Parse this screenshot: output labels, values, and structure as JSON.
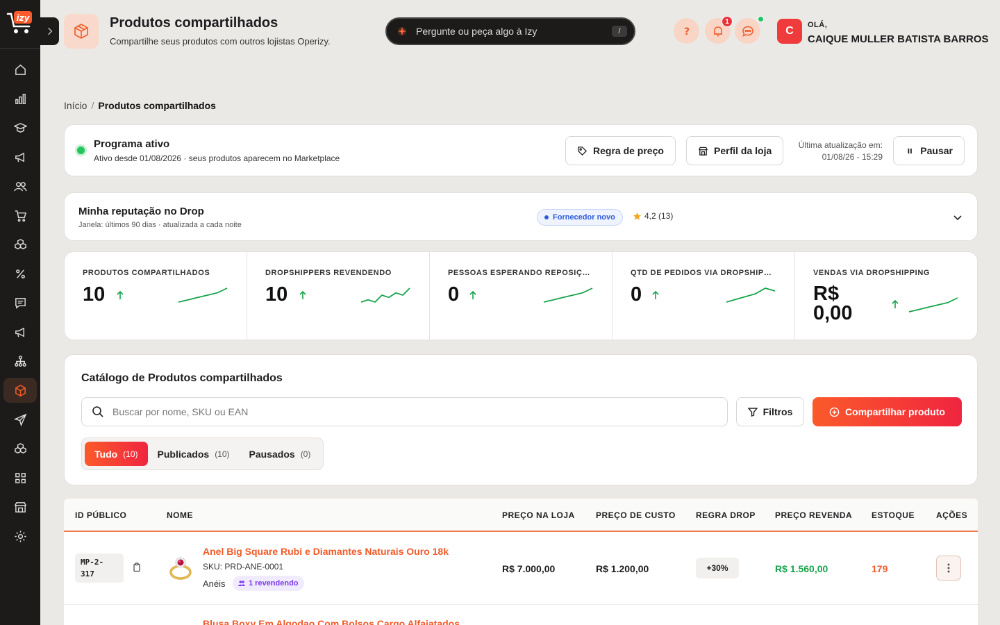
{
  "header": {
    "title": "Produtos compartilhados",
    "subtitle": "Compartilhe seus produtos com outros lojistas Operizy.",
    "ask_placeholder": "Pergunte ou peça algo à Izy",
    "ask_shortcut": "/",
    "notif_count": "1",
    "greeting": "OLÁ,",
    "user_name": "CAIQUE MULLER BATISTA BARROS",
    "avatar_initial": "C"
  },
  "breadcrumb": {
    "home": "Início",
    "sep": "/",
    "current": "Produtos compartilhados"
  },
  "program": {
    "title": "Programa ativo",
    "subtitle": "Ativo desde 01/08/2026 · seus produtos aparecem no Marketplace",
    "price_rule_btn": "Regra de preço",
    "store_profile_btn": "Perfil da loja",
    "updated_label": "Última atualização em:",
    "updated_value": "01/08/26 - 15:29",
    "pause_btn": "Pausar"
  },
  "reputation": {
    "title": "Minha reputação no Drop",
    "subtitle": "Janela: últimos 90 dias · atualizada a cada noite",
    "badge": "Fornecedor novo",
    "rating": "4,2 (13)"
  },
  "metrics": [
    {
      "label": "PRODUTOS COMPARTILHADOS",
      "value": "10",
      "trend": [
        3,
        4,
        5,
        6,
        7,
        9
      ]
    },
    {
      "label": "DROPSHIPPERS REVENDENDO",
      "value": "10",
      "trend": [
        3,
        4,
        3,
        6,
        5,
        7,
        6,
        9
      ]
    },
    {
      "label": "PESSOAS ESPERANDO REPOSIÇÃO",
      "value": "0",
      "trend": [
        3,
        4,
        5,
        6,
        7,
        9
      ]
    },
    {
      "label": "QTD DE PEDIDOS VIA DROPSHIPPI...",
      "value": "0",
      "trend": [
        3,
        4,
        5,
        6,
        8,
        7
      ]
    },
    {
      "label": "VENDAS VIA DROPSHIPPING",
      "value": "R$ 0,00",
      "value_line1": "R$",
      "value_line2": "0,00",
      "trend": [
        3,
        4,
        5,
        6,
        7,
        9
      ]
    }
  ],
  "catalog": {
    "title": "Catálogo de Produtos compartilhados",
    "search_placeholder": "Buscar por nome, SKU ou EAN",
    "filters_btn": "Filtros",
    "share_btn": "Compartilhar produto",
    "tabs": [
      {
        "label": "Tudo",
        "count": "(10)"
      },
      {
        "label": "Publicados",
        "count": "(10)"
      },
      {
        "label": "Pausados",
        "count": "(0)"
      }
    ]
  },
  "table": {
    "columns": [
      "ID PÚBLICO",
      "NOME",
      "PREÇO NA LOJA",
      "PREÇO DE CUSTO",
      "REGRA DROP",
      "PREÇO REVENDA",
      "ESTOQUE",
      "AÇÕES"
    ],
    "rows": [
      {
        "id_line1": "MP-2-",
        "id_line2": "317",
        "name": "Anel Big Square Rubi e Diamantes Naturais Ouro 18k",
        "sku": "SKU: PRD-ANE-0001",
        "category": "Anéis",
        "resellers": "1 revendendo",
        "store_price": "R$ 7.000,00",
        "cost_price": "R$ 1.200,00",
        "drop_rule": "+30%",
        "resale_price": "R$ 1.560,00",
        "stock": "179"
      },
      {
        "name": "Blusa Boxy Em Algodao Com Bolsos Cargo Alfaiatados"
      }
    ]
  },
  "colors": {
    "accent": "#f15a29",
    "sidebar": "#1c1b1a",
    "success": "#16a34a"
  }
}
